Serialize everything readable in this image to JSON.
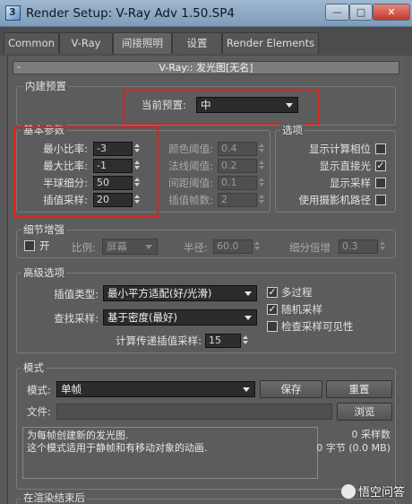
{
  "window": {
    "title": "Render Setup: V-Ray Adv 1.50.SP4",
    "icon_glyph": "3",
    "minimize": "—",
    "maximize": "□",
    "close": "✕"
  },
  "tabs": [
    "Common",
    "V-Ray",
    "间接照明",
    "设置",
    "Render Elements"
  ],
  "rollout": {
    "collapse": "-",
    "title": "V-Ray:: 发光图[无名]"
  },
  "builtin": {
    "label": "内建预置",
    "preset_label": "当前预置:",
    "preset_value": "中"
  },
  "basic": {
    "label": "基本参数",
    "left": [
      {
        "label": "最小比率:",
        "value": "-3"
      },
      {
        "label": "最大比率:",
        "value": "-1"
      },
      {
        "label": "半球细分:",
        "value": "50"
      },
      {
        "label": "插值采样:",
        "value": "20"
      }
    ],
    "mid": [
      {
        "label": "颜色阈值:",
        "value": "0.4"
      },
      {
        "label": "法线阈值:",
        "value": "0.2"
      },
      {
        "label": "间距阈值:",
        "value": "0.1"
      },
      {
        "label": "插值帧数:",
        "value": "2"
      }
    ]
  },
  "options": {
    "label": "选项",
    "items": [
      {
        "label": "显示计算相位",
        "mark": ""
      },
      {
        "label": "显示直接光",
        "mark": "✓"
      },
      {
        "label": "显示采样",
        "mark": ""
      },
      {
        "label": "使用摄影机路径",
        "mark": ""
      }
    ]
  },
  "detail": {
    "label": "细节增强",
    "on_label": "开",
    "scale_label": "比例:",
    "scale_value": "屏幕",
    "radius_label": "半径:",
    "radius_value": "60.0",
    "subdiv_label": "细分倍增",
    "subdiv_value": "0.3"
  },
  "advanced": {
    "label": "高级选项",
    "interp_label": "插值类型:",
    "interp_value": "最小平方适配(好/光滑)",
    "lookup_label": "查找采样:",
    "lookup_value": "基于密度(最好)",
    "calc_label": "计算传递插值采样:",
    "calc_value": "15",
    "checks": [
      {
        "label": "多过程",
        "mark": "✓"
      },
      {
        "label": "随机采样",
        "mark": "✓"
      },
      {
        "label": "检查采样可见性",
        "mark": ""
      }
    ]
  },
  "mode": {
    "label": "模式",
    "mode_label": "模式:",
    "mode_value": "单帧",
    "save": "保存",
    "reset": "重置",
    "file_label": "文件:",
    "browse": "浏览",
    "desc1": "为每帧创建新的发光图.",
    "desc2": "这个模式适用于静帧和有移动对象的动画.",
    "samples": "0 采样数",
    "bytes": "0 字节 (0.0 MB)"
  },
  "after": {
    "label": "在渲染结束后"
  },
  "watermark": {
    "text": "悟空问答"
  }
}
